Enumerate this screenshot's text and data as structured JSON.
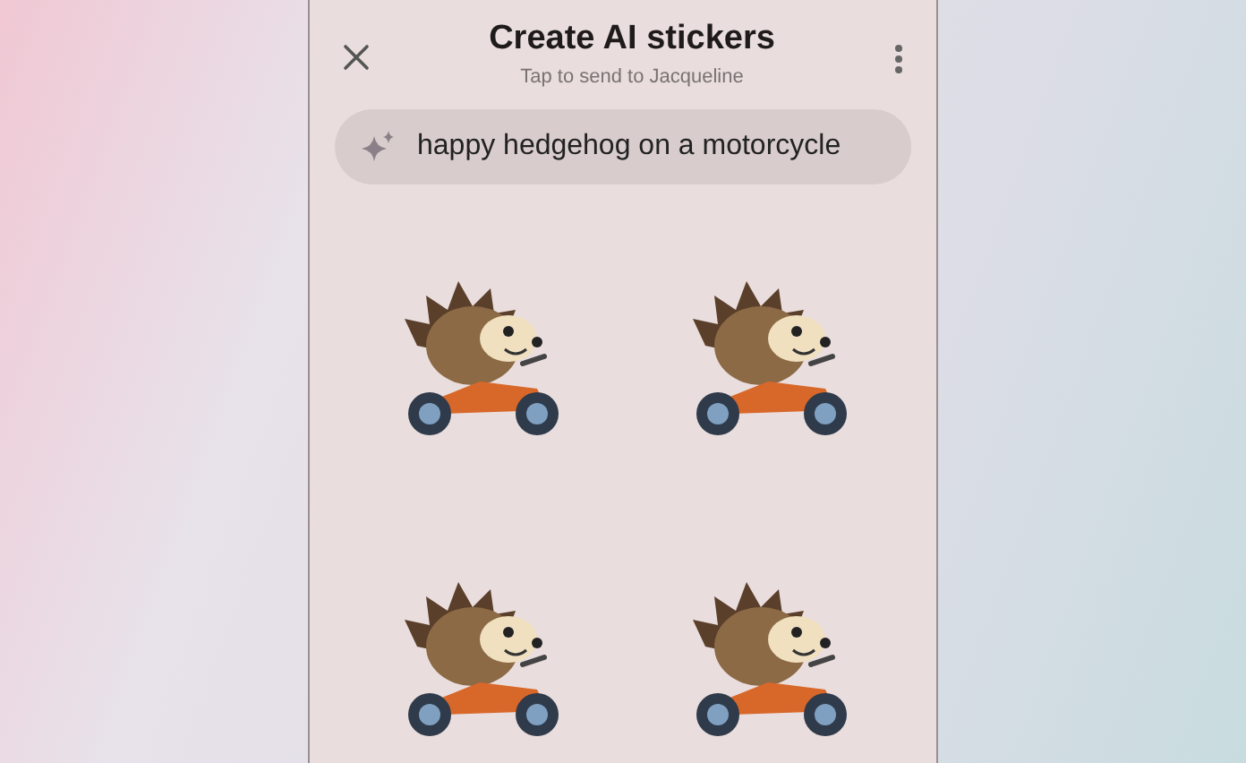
{
  "header": {
    "title": "Create AI stickers",
    "subtitle": "Tap to send to Jacqueline"
  },
  "prompt": {
    "value": "happy hedgehog on a motorcycle"
  }
}
